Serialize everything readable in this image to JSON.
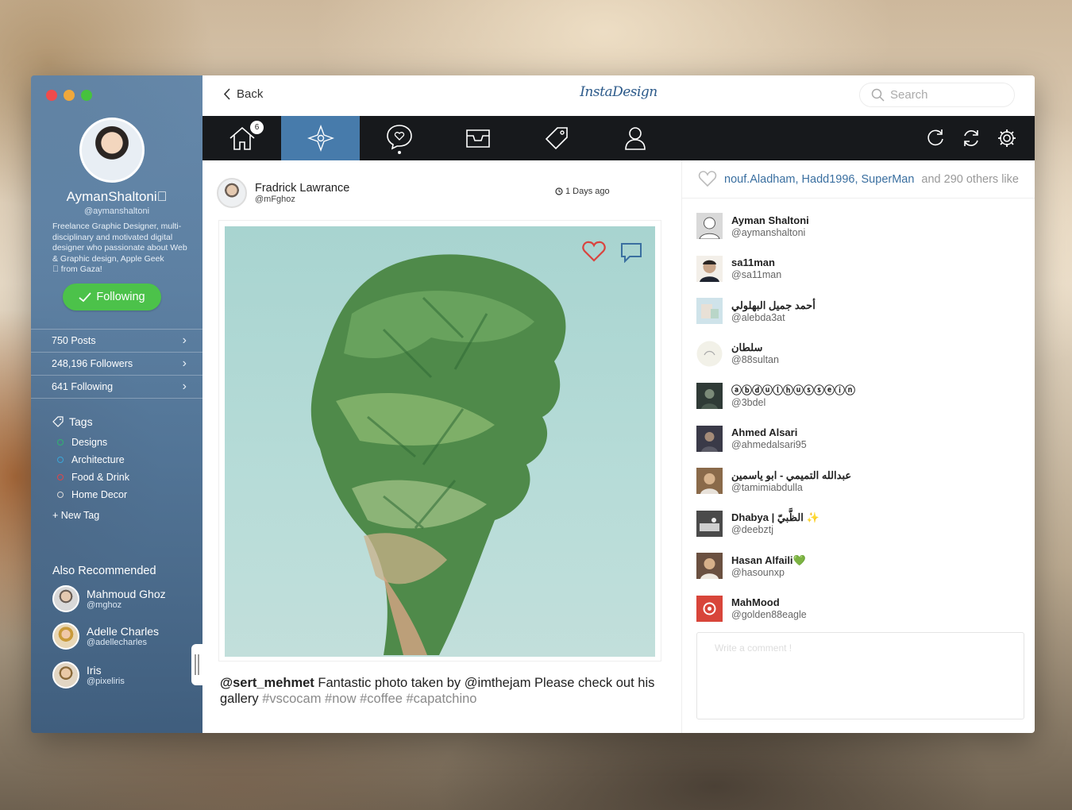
{
  "window": {
    "controls": [
      "close",
      "minimize",
      "maximize"
    ]
  },
  "sidebar": {
    "profile": {
      "name": "AymanShaltoni",
      "handle": "@aymanshaltoni",
      "bio": "Freelance Graphic Designer, multi-disciplinary and motivated digital designer who passionate about Web & Graphic design, Apple Geek",
      "bio_suffix": "from Gaza!",
      "follow_label": "Following"
    },
    "stats": [
      {
        "label": "750 Posts"
      },
      {
        "label": "248,196 Followers"
      },
      {
        "label": "641 Following"
      }
    ],
    "tags_title": "Tags",
    "tags": [
      {
        "label": "Designs",
        "color": "#2fb36f"
      },
      {
        "label": "Architecture",
        "color": "#3aa6d8"
      },
      {
        "label": "Food & Drink",
        "color": "#e0454a"
      },
      {
        "label": "Home Decor",
        "color": "#d9d9d9"
      }
    ],
    "new_tag": "+ New Tag",
    "also_title": "Also Recommended",
    "recommended": [
      {
        "name": "Mahmoud Ghoz",
        "handle": "@mghoz"
      },
      {
        "name": "Adelle Charles",
        "handle": "@adellecharles"
      },
      {
        "name": "Iris",
        "handle": "@pixeliris"
      }
    ]
  },
  "topbar": {
    "back_label": "Back",
    "logo": "InstaDesign",
    "search_placeholder": "Search"
  },
  "nav": {
    "items": [
      "home-icon",
      "compass-icon",
      "chat-icon",
      "inbox-icon",
      "tag-icon",
      "user-icon"
    ],
    "active_index": 1,
    "home_badge": "6",
    "right_icons": [
      "refresh-icon",
      "sync-icon",
      "settings-icon"
    ]
  },
  "post": {
    "author_name": "Fradrick Lawrance",
    "author_handle": "@mFghoz",
    "time": "1 Days ago",
    "caption_user": "@sert_mehmet",
    "caption_text": " Fantastic photo taken by @imthejam Please check out his gallery ",
    "caption_tags": "#vscocam #now #coffee #capatchino"
  },
  "likes": {
    "names": "nouf.Aladham, Hadd1996, SuperMan",
    "rest": "and 290 others like",
    "users": [
      {
        "name": "Ayman Shaltoni",
        "handle": "@aymanshaltoni",
        "avatar_color": "#d9d9d9"
      },
      {
        "name": "sa11man",
        "handle": "@sa11man",
        "avatar_color": "#c9a68a"
      },
      {
        "name": "أحمد جميل البهلولي",
        "handle": "@alebda3at",
        "avatar_color": "#cfe3ea"
      },
      {
        "name": "سلطان",
        "handle": "@88sultan",
        "avatar_color": "#f2f1e8"
      },
      {
        "name": "ⓐⓑⓓⓤⓛⓗⓤⓢⓢⓔⓘⓝ",
        "handle": "@3bdel",
        "avatar_color": "#2f3a36"
      },
      {
        "name": "Ahmed Alsari",
        "handle": "@ahmedalsari95",
        "avatar_color": "#3a3a48"
      },
      {
        "name": "عبدالله التميمي - ابو ياسمين",
        "handle": "@tamimiabdulla",
        "avatar_color": "#8a6a4a"
      },
      {
        "name": "Dhabya | الظَّبيّ ✨",
        "handle": "@deebztj",
        "avatar_color": "#4a4a4a"
      },
      {
        "name": "Hasan Alfaili💚",
        "handle": "@hasounxp",
        "avatar_color": "#6a5040"
      },
      {
        "name": "MahMood",
        "handle": "@golden88eagle",
        "avatar_color": "#d8453a"
      }
    ],
    "comment_placeholder": "Write a comment !"
  }
}
